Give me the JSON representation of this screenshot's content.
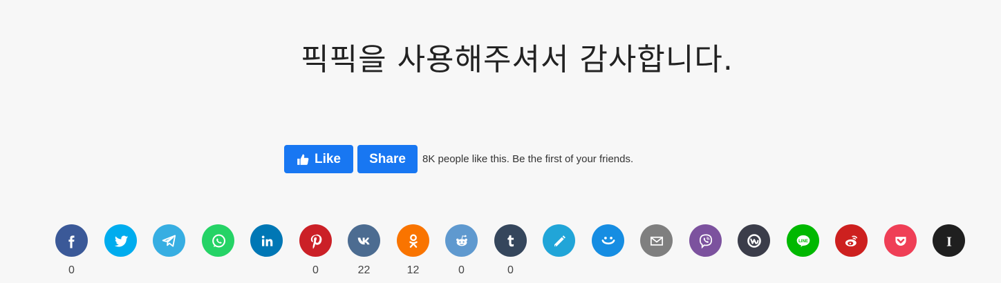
{
  "heading": "픽픽을 사용해주셔서 감사합니다.",
  "facebook": {
    "like_label": "Like",
    "share_label": "Share",
    "social_text": "8K people like this. Be the first of your friends.",
    "color": "#1877f2"
  },
  "share_buttons": [
    {
      "name": "facebook",
      "icon": "facebook-icon",
      "color": "#3b5998",
      "count": "0"
    },
    {
      "name": "twitter",
      "icon": "twitter-icon",
      "color": "#00acee",
      "count": ""
    },
    {
      "name": "telegram",
      "icon": "telegram-icon",
      "color": "#37aee2",
      "count": ""
    },
    {
      "name": "whatsapp",
      "icon": "whatsapp-icon",
      "color": "#25d366",
      "count": ""
    },
    {
      "name": "linkedin",
      "icon": "linkedin-icon",
      "color": "#0077b5",
      "count": ""
    },
    {
      "name": "pinterest",
      "icon": "pinterest-icon",
      "color": "#cb2027",
      "count": "0"
    },
    {
      "name": "vk",
      "icon": "vk-icon",
      "color": "#4c6c91",
      "count": "22"
    },
    {
      "name": "odnoklassniki",
      "icon": "odnoklassniki-icon",
      "color": "#f97400",
      "count": "12"
    },
    {
      "name": "reddit",
      "icon": "reddit-icon",
      "color": "#5f99cf",
      "count": "0"
    },
    {
      "name": "tumblr",
      "icon": "tumblr-icon",
      "color": "#35465c",
      "count": "0"
    },
    {
      "name": "livejournal",
      "icon": "livejournal-icon",
      "color": "#21a5d8",
      "count": ""
    },
    {
      "name": "mailru",
      "icon": "mailru-smile-icon",
      "color": "#168de2",
      "count": ""
    },
    {
      "name": "email",
      "icon": "email-icon",
      "color": "#7f7f7f",
      "count": ""
    },
    {
      "name": "viber",
      "icon": "viber-icon",
      "color": "#7c529e",
      "count": ""
    },
    {
      "name": "workplace",
      "icon": "workplace-icon",
      "color": "#3b3d4a",
      "count": ""
    },
    {
      "name": "line",
      "icon": "line-icon",
      "color": "#00b800",
      "count": ""
    },
    {
      "name": "weibo",
      "icon": "weibo-icon",
      "color": "#cd201f",
      "count": ""
    },
    {
      "name": "pocket",
      "icon": "pocket-icon",
      "color": "#ef3f56",
      "count": ""
    },
    {
      "name": "instapaper",
      "icon": "instapaper-icon",
      "color": "#1f1f1f",
      "count": ""
    }
  ]
}
